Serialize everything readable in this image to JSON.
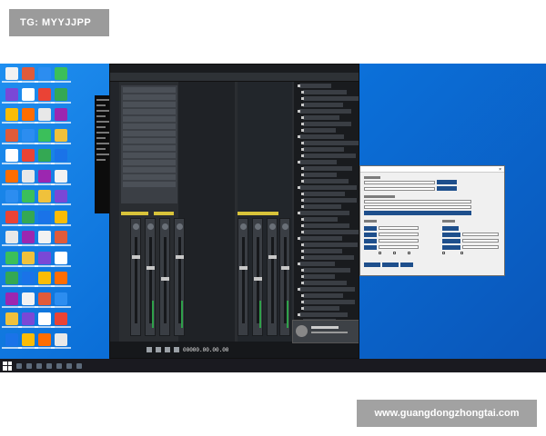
{
  "overlay": {
    "tg_label": "TG: MYYJJPP",
    "url_label": "www.guangdongzhongtai.com"
  },
  "desktop": {
    "icon_colors": [
      "#f2f2f2",
      "#e05b3a",
      "#2c8df0",
      "#3bbf5a",
      "#f0c13b",
      "#7a48d6",
      "#ffffff",
      "#ea4335",
      "#34a853",
      "#1a73e8",
      "#fbbc05",
      "#ff6d00",
      "#e8e8e8",
      "#9c27b0"
    ]
  },
  "daw": {
    "timecode": "00000.00.00.00",
    "brand_color": "#d8c33a"
  },
  "colors": {
    "desktop_bg": "#0b6fd8",
    "dialog_accent": "#1e4f8c"
  }
}
